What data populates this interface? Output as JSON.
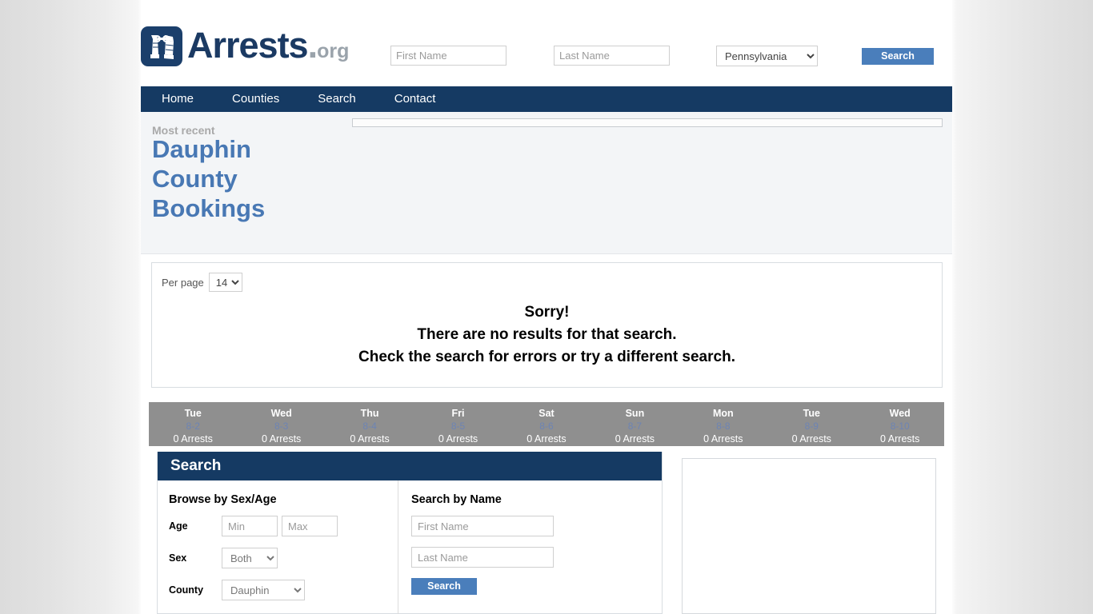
{
  "header": {
    "logo_name": "handcuffs-icon",
    "brand_main": "Arrests",
    "brand_dot": ".",
    "brand_tld": "org",
    "first_name_placeholder": "First Name",
    "first_name_value": "",
    "last_name_placeholder": "Last Name",
    "last_name_value": "",
    "state_selected": "Pennsylvania",
    "state_options": [
      "Pennsylvania"
    ],
    "search_label": "Search"
  },
  "nav": {
    "items": [
      {
        "label": "Home"
      },
      {
        "label": "Counties"
      },
      {
        "label": "Search"
      },
      {
        "label": "Contact"
      }
    ]
  },
  "hero": {
    "eyebrow": "Most recent",
    "title": "Dauphin County Bookings"
  },
  "results": {
    "per_page_label": "Per page",
    "per_page_selected": "14",
    "per_page_options": [
      "14"
    ],
    "no_results_line1": "Sorry!",
    "no_results_line2": "There are no results for that search.",
    "no_results_line3": "Check the search for errors or try a different search."
  },
  "date_strip": {
    "days": [
      {
        "dow": "Tue",
        "date": "8-2",
        "count": "0 Arrests"
      },
      {
        "dow": "Wed",
        "date": "8-3",
        "count": "0 Arrests"
      },
      {
        "dow": "Thu",
        "date": "8-4",
        "count": "0 Arrests"
      },
      {
        "dow": "Fri",
        "date": "8-5",
        "count": "0 Arrests"
      },
      {
        "dow": "Sat",
        "date": "8-6",
        "count": "0 Arrests"
      },
      {
        "dow": "Sun",
        "date": "8-7",
        "count": "0 Arrests"
      },
      {
        "dow": "Mon",
        "date": "8-8",
        "count": "0 Arrests"
      },
      {
        "dow": "Tue",
        "date": "8-9",
        "count": "0 Arrests"
      },
      {
        "dow": "Wed",
        "date": "8-10",
        "count": "0 Arrests"
      }
    ]
  },
  "search_panel": {
    "title": "Search",
    "browse_heading": "Browse by Sex/Age",
    "age_label": "Age",
    "age_min_placeholder": "Min",
    "age_min_value": "",
    "age_max_placeholder": "Max",
    "age_max_value": "",
    "sex_label": "Sex",
    "sex_selected": "Both",
    "sex_options": [
      "Both"
    ],
    "county_label": "County",
    "county_selected": "Dauphin",
    "county_options": [
      "Dauphin"
    ],
    "name_heading": "Search by Name",
    "first_name_placeholder": "First Name",
    "first_name_value": "",
    "last_name_placeholder": "Last Name",
    "last_name_value": "",
    "submit_label": "Search"
  },
  "colors": {
    "navy": "#153a63",
    "link_blue": "#4878b4",
    "button_blue": "#4a7ebb",
    "strip_grey": "#8f8f8f",
    "hero_bg": "#f3f5f7"
  }
}
